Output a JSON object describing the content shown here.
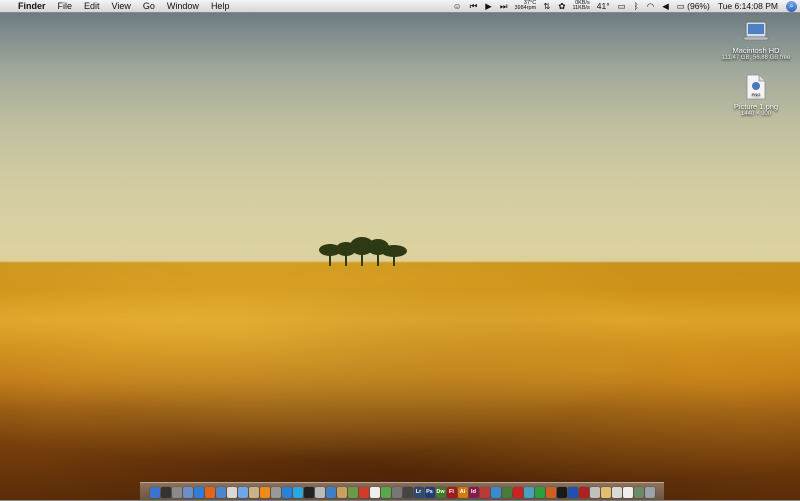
{
  "menubar": {
    "app_name": "Finder",
    "menus": [
      "File",
      "Edit",
      "View",
      "Go",
      "Window",
      "Help"
    ],
    "status": {
      "cpu_temp": "37°C",
      "fan_rpm": "3984rpm",
      "net_up": "0KB/s",
      "net_down": "11KB/s",
      "weather_temp": "41°",
      "battery_percent": "(96%)",
      "clock": "Tue 6:14:08 PM"
    }
  },
  "desktop": {
    "items": [
      {
        "label": "Macintosh HD",
        "sub": "111.47 GB, 56.88 GB free",
        "icon": "hard-drive-icon"
      },
      {
        "label": "Picture 1.png",
        "sub": "1440 × 900",
        "icon": "png-file-icon",
        "badge": "PNG"
      }
    ]
  },
  "dock": {
    "items": [
      {
        "name": "finder",
        "glyph": "",
        "color": "#3b73d1"
      },
      {
        "name": "dashboard",
        "glyph": "",
        "color": "#333333"
      },
      {
        "name": "system-preferences",
        "glyph": "",
        "color": "#8a8a8a"
      },
      {
        "name": "mail",
        "glyph": "",
        "color": "#6a8fc9"
      },
      {
        "name": "safari",
        "glyph": "",
        "color": "#2f7fd8"
      },
      {
        "name": "firefox",
        "glyph": "",
        "color": "#e0661b"
      },
      {
        "name": "itunes",
        "glyph": "",
        "color": "#4c86c9"
      },
      {
        "name": "ical",
        "glyph": "",
        "color": "#d8d8d8"
      },
      {
        "name": "ichat",
        "glyph": "",
        "color": "#6ea6e8"
      },
      {
        "name": "preview",
        "glyph": "",
        "color": "#c9b48a"
      },
      {
        "name": "vlc",
        "glyph": "",
        "color": "#f08a1c"
      },
      {
        "name": "utility",
        "glyph": "",
        "color": "#999999"
      },
      {
        "name": "quicktime",
        "glyph": "",
        "color": "#2a82d6"
      },
      {
        "name": "skype",
        "glyph": "",
        "color": "#2aa6e0"
      },
      {
        "name": "terminal",
        "glyph": "",
        "color": "#222222"
      },
      {
        "name": "tool",
        "glyph": "",
        "color": "#bbbbbb"
      },
      {
        "name": "xcode",
        "glyph": "",
        "color": "#3f7fc5"
      },
      {
        "name": "script-editor",
        "glyph": "",
        "color": "#c8a060"
      },
      {
        "name": "photo",
        "glyph": "",
        "color": "#6a9a4a"
      },
      {
        "name": "app",
        "glyph": "",
        "color": "#d23a2a"
      },
      {
        "name": "textedit",
        "glyph": "",
        "color": "#eeeeee"
      },
      {
        "name": "adium",
        "glyph": "",
        "color": "#5aa64a"
      },
      {
        "name": "disk",
        "glyph": "",
        "color": "#777777"
      },
      {
        "name": "camera",
        "glyph": "",
        "color": "#444444"
      },
      {
        "name": "lightroom",
        "glyph": "Lr",
        "color": "#2d4a6e"
      },
      {
        "name": "photoshop",
        "glyph": "Ps",
        "color": "#1c3f78"
      },
      {
        "name": "dreamweaver",
        "glyph": "Dw",
        "color": "#3e7a2a"
      },
      {
        "name": "flash",
        "glyph": "Fl",
        "color": "#a21a1a"
      },
      {
        "name": "illustrator",
        "glyph": "Ai",
        "color": "#d47a12"
      },
      {
        "name": "indesign",
        "glyph": "Id",
        "color": "#8a1a4a"
      },
      {
        "name": "app-2",
        "glyph": "",
        "color": "#b83a3a"
      },
      {
        "name": "app-3",
        "glyph": "",
        "color": "#3a8ad0"
      },
      {
        "name": "app-4",
        "glyph": "",
        "color": "#4a7a3a"
      },
      {
        "name": "app-5",
        "glyph": "",
        "color": "#cc2222"
      },
      {
        "name": "app-6",
        "glyph": "",
        "color": "#4aa0c0"
      },
      {
        "name": "app-7",
        "glyph": "",
        "color": "#2aa040"
      },
      {
        "name": "app-8",
        "glyph": "",
        "color": "#d06020"
      },
      {
        "name": "app-9",
        "glyph": "",
        "color": "#1a1a1a"
      },
      {
        "name": "app-10",
        "glyph": "",
        "color": "#2050b0"
      },
      {
        "name": "app-11",
        "glyph": "",
        "color": "#b02020"
      },
      {
        "name": "app-12",
        "glyph": "",
        "color": "#c0c0c0"
      },
      {
        "name": "app-13",
        "glyph": "",
        "color": "#e0c070"
      },
      {
        "name": "app-14",
        "glyph": "",
        "color": "#d8d8d8"
      },
      {
        "name": "app-15",
        "glyph": "",
        "color": "#eeeeee"
      },
      {
        "name": "app-16",
        "glyph": "",
        "color": "#6a8a6a"
      },
      {
        "name": "trash",
        "glyph": "",
        "color": "#9aa3aa"
      }
    ]
  }
}
